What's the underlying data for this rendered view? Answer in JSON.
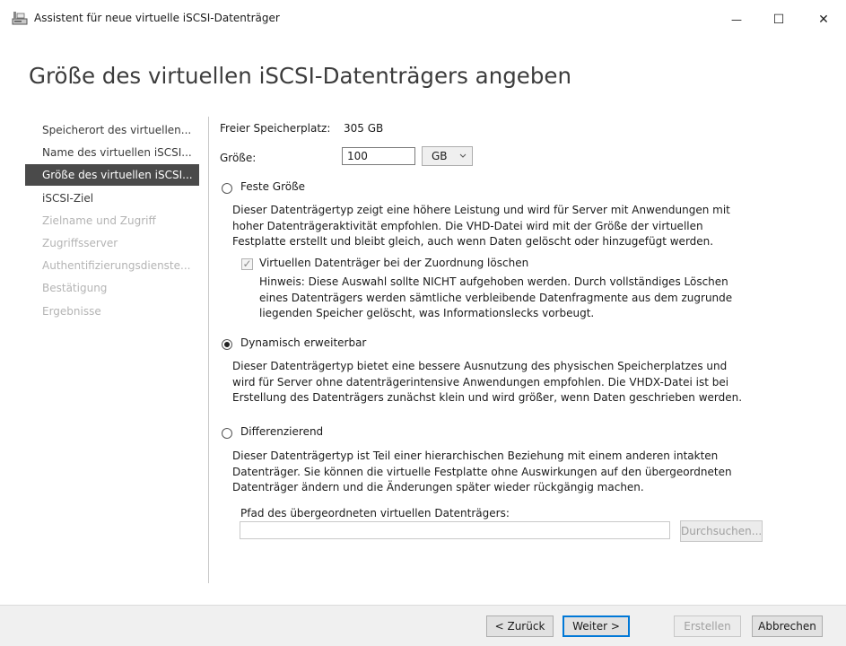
{
  "window": {
    "title": "Assistent für neue virtuelle iSCSI-Datenträger",
    "controls": {
      "minimize": "—",
      "maximize": "☐",
      "close": "✕"
    }
  },
  "page_title": "Größe des virtuellen iSCSI-Datenträgers angeben",
  "nav": {
    "items": [
      {
        "label": "Speicherort des virtuellen...",
        "state": "done"
      },
      {
        "label": "Name des virtuellen iSCSI...",
        "state": "done"
      },
      {
        "label": "Größe des virtuellen iSCSI...",
        "state": "active"
      },
      {
        "label": "iSCSI-Ziel",
        "state": "done"
      },
      {
        "label": "Zielname und Zugriff",
        "state": "disabled"
      },
      {
        "label": "Zugriffsserver",
        "state": "disabled"
      },
      {
        "label": "Authentifizierungsdienste...",
        "state": "disabled"
      },
      {
        "label": "Bestätigung",
        "state": "disabled"
      },
      {
        "label": "Ergebnisse",
        "state": "disabled"
      }
    ]
  },
  "free_space": {
    "label": "Freier Speicherplatz:",
    "value": "305 GB"
  },
  "size": {
    "label": "Größe:",
    "value": "100",
    "unit": "GB"
  },
  "fixed": {
    "label": "Feste Größe",
    "checked": false,
    "description": [
      "Dieser Datenträgertyp zeigt eine höhere Leistung und wird für Server mit Anwendungen mit",
      "hoher Datenträgeraktivität empfohlen. Die VHD-Datei wird mit der Größe der virtuellen",
      "Festplatte erstellt und bleibt gleich, auch wenn Daten gelöscht oder hinzugefügt werden."
    ],
    "clear_checkbox": {
      "label": "Virtuellen Datenträger bei der Zuordnung löschen",
      "checked": true,
      "hint": [
        "Hinweis: Diese Auswahl sollte NICHT aufgehoben werden. Durch vollständiges Löschen",
        "eines Datenträgers werden sämtliche verbleibende Datenfragmente aus dem zugrunde",
        "liegenden Speicher gelöscht, was Informationslecks vorbeugt."
      ]
    }
  },
  "dynamic": {
    "label": "Dynamisch erweiterbar",
    "checked": true,
    "description": [
      "Dieser Datenträgertyp bietet eine bessere Ausnutzung des physischen Speicherplatzes und",
      "wird für Server ohne datenträgerintensive Anwendungen empfohlen. Die VHDX-Datei ist bei",
      "Erstellung des Datenträgers zunächst klein und wird größer, wenn Daten geschrieben werden."
    ]
  },
  "differencing": {
    "label": "Differenzierend",
    "checked": false,
    "description": [
      "Dieser Datenträgertyp ist Teil einer hierarchischen Beziehung mit einem anderen intakten",
      "Datenträger. Sie können die virtuelle Festplatte ohne Auswirkungen auf den übergeordneten",
      "Datenträger ändern und die Änderungen später wieder rückgängig machen."
    ],
    "parent_path_label": "Pfad des übergeordneten virtuellen Datenträgers:",
    "parent_path_value": "",
    "browse_label": "Durchsuchen..."
  },
  "footer": {
    "back": "< Zurück",
    "next": "Weiter >",
    "create": "Erstellen",
    "cancel": "Abbrechen"
  },
  "icons": {
    "select_arrow": "chevron-down-icon",
    "app": "wizard-disk-icon"
  }
}
